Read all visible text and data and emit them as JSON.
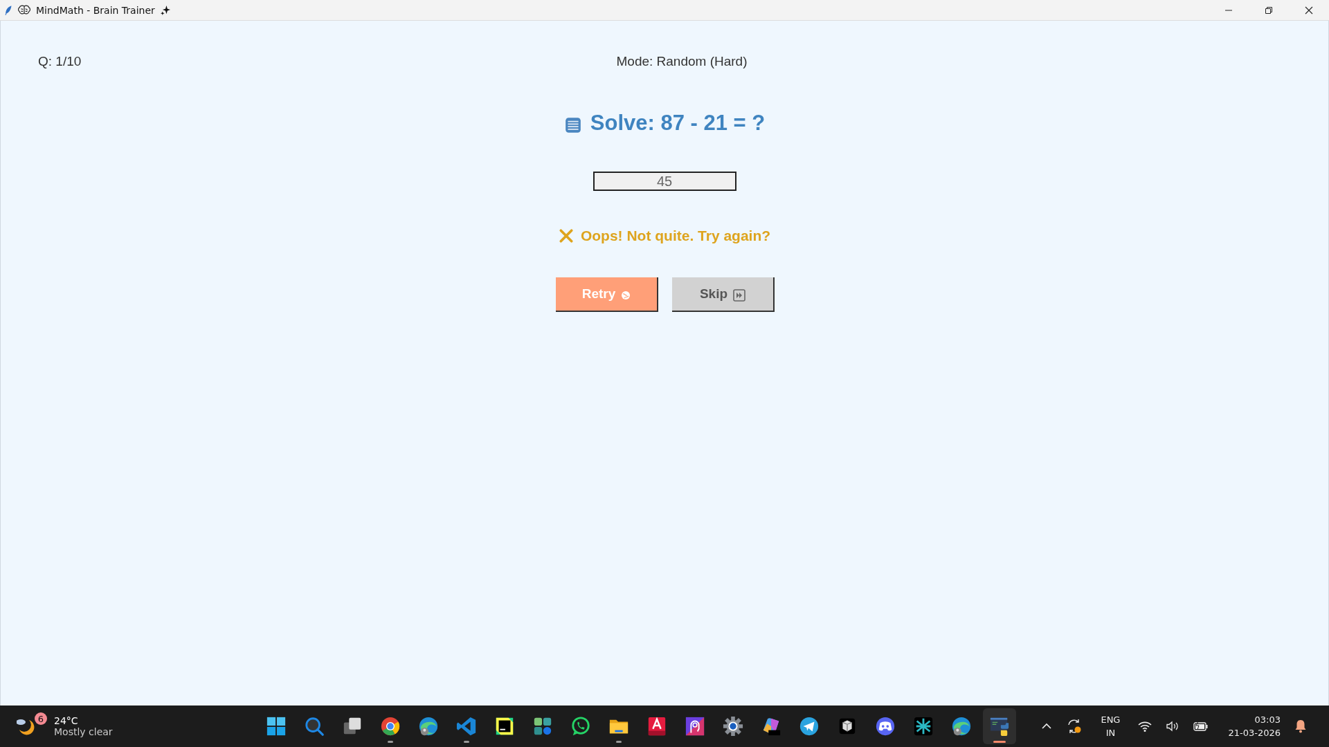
{
  "window": {
    "title": "MindMath - Brain Trainer"
  },
  "header": {
    "question": "Q: 1/10",
    "mode": "Mode: Random (Hard)"
  },
  "prompt": "Solve: 87 - 21 = ?",
  "answer": {
    "value": "45"
  },
  "feedback": {
    "kind": "wrong",
    "text": "Oops! Not quite. Try again?"
  },
  "buttons": [
    {
      "label": "Retry",
      "kind": "retry"
    },
    {
      "label": "Skip",
      "kind": "skip"
    }
  ],
  "taskbar": {
    "weather": {
      "badge": "6",
      "temperature": "24°C",
      "condition": "Mostly clear"
    },
    "apps": [
      {
        "kind": "start",
        "running": false,
        "active": false
      },
      {
        "kind": "search",
        "running": false,
        "active": false
      },
      {
        "kind": "taskview",
        "running": false,
        "active": false
      },
      {
        "kind": "browser-ring",
        "running": true,
        "active": false
      },
      {
        "kind": "browser-wave",
        "running": false,
        "active": false
      },
      {
        "kind": "code",
        "running": true,
        "active": false
      },
      {
        "kind": "ide",
        "running": false,
        "active": false
      },
      {
        "kind": "tiles",
        "running": false,
        "active": false
      },
      {
        "kind": "chat",
        "running": false,
        "active": false
      },
      {
        "kind": "folder",
        "running": true,
        "active": false
      },
      {
        "kind": "cad",
        "running": false,
        "active": false
      },
      {
        "kind": "portrait",
        "running": false,
        "active": false
      },
      {
        "kind": "gear",
        "running": false,
        "active": false
      },
      {
        "kind": "office",
        "running": false,
        "active": false
      },
      {
        "kind": "plane",
        "running": false,
        "active": false
      },
      {
        "kind": "cube",
        "running": false,
        "active": false
      },
      {
        "kind": "gamepad",
        "running": false,
        "active": false
      },
      {
        "kind": "star",
        "running": false,
        "active": false
      },
      {
        "kind": "browser-wave",
        "running": false,
        "active": false
      },
      {
        "kind": "python",
        "running": true,
        "active": true
      }
    ],
    "language": {
      "line1": "ENG",
      "line2": "IN"
    },
    "time": "03:03",
    "date": "21-03-2026"
  }
}
